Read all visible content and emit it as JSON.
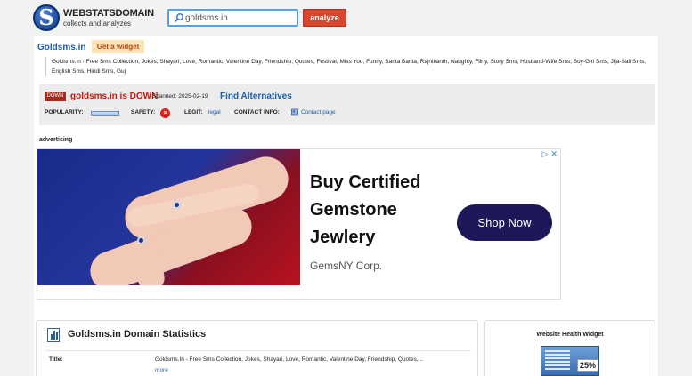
{
  "header": {
    "logo_letter": "S",
    "logo_title": "WEBSTATSDOMAIN",
    "logo_subtitle": "collects and analyzes",
    "search_value": "goldsms.in",
    "analyze_label": "analyze"
  },
  "domain": {
    "name": "Goldsms.in",
    "widget_label": "Get a widget",
    "description": "Goldsms.In - Free Sms Collection, Jokes, Shayari, Love, Romantic, Valentine Day, Friendship, Quotes, Festival, Miss You, Funny, Santa Banta, Rajnikanth, Naughty, Flirty, Story Sms, Husband-Wife Sms, Boy-Girl Sms, Jija-Sali Sms, English Sms, Hindi Sms, Guj"
  },
  "status": {
    "badge": "DOWN",
    "down_text": "goldsms.in is DOWN",
    "scanned": "Scanned: 2025-02-19",
    "find_alternatives": "Find Alternatives",
    "popularity_label": "POPULARITY:",
    "safety_label": "SAFETY:",
    "safety_icon": "×",
    "legit_label": "LEGIT:",
    "legit_value": "legal",
    "contact_label": "CONTACT INFO:",
    "contact_value": "Contact page"
  },
  "advertising": {
    "label": "advertising",
    "headline": "Buy Certified Gemstone Jewlery",
    "brand": "GemsNY Corp.",
    "cta": "Shop Now",
    "corner": "▷ ✕"
  },
  "stats": {
    "title": "Goldsms.in Domain Statistics",
    "title_label": "Title:",
    "title_value": "Goldsms.In - Free Sms Collection, Jokes, Shayari, Love, Romantic, Valentine Day, Friendship, Quotes,...",
    "more": "more"
  },
  "health_widget": {
    "title": "Website Health Widget",
    "percent": "25%"
  },
  "colors": {
    "accent": "#1d5fa8",
    "analyze_button": "#d8462d",
    "down": "#c41a0e"
  }
}
